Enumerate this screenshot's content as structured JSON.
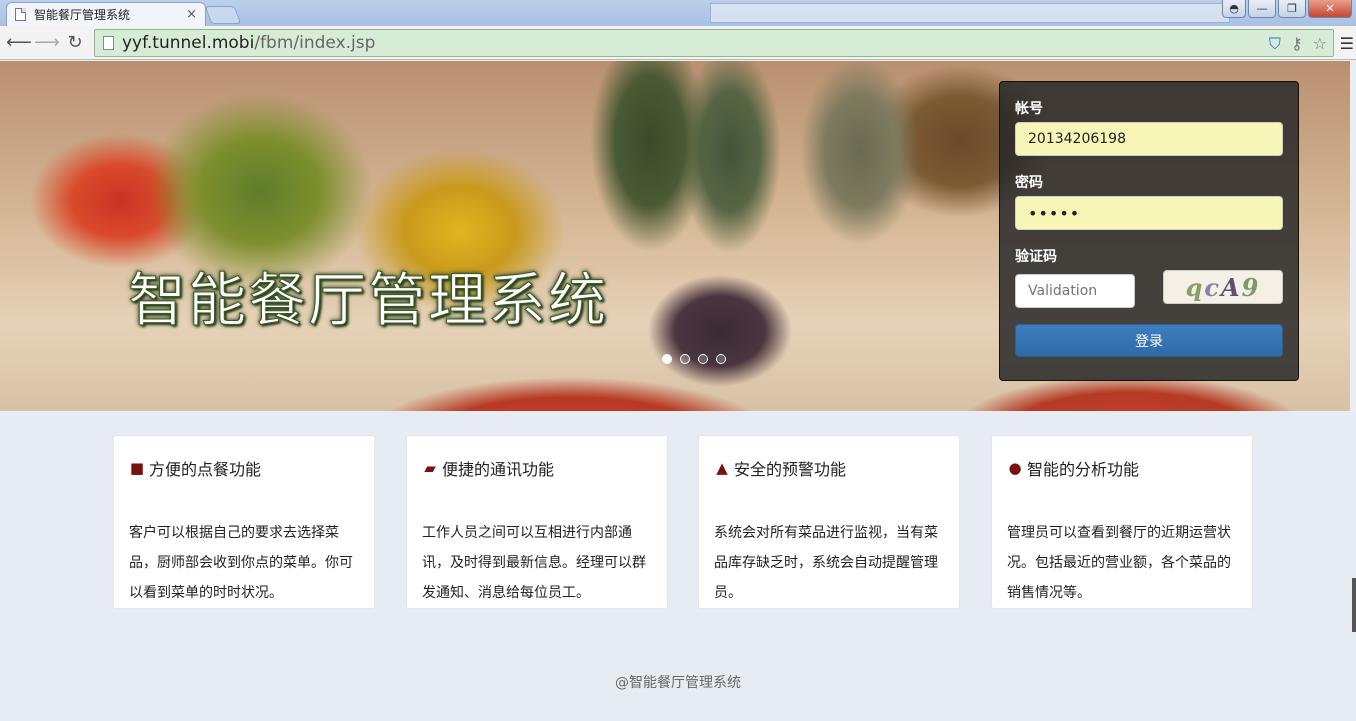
{
  "browser": {
    "tab_title": "智能餐厅管理系统",
    "tab_close": "×",
    "url_host": "yyf.tunnel.mobi",
    "url_path": "/fbm/index.jsp",
    "winbtn_user": "◓",
    "winbtn_min": "—",
    "winbtn_max": "❐",
    "winbtn_close": "✕"
  },
  "hero": {
    "title": "智能餐厅管理系统",
    "slides": 4,
    "active_slide": 1
  },
  "login": {
    "account_label": "帐号",
    "account_value": "20134206198",
    "password_label": "密码",
    "password_value": "12345",
    "captcha_label": "验证码",
    "captcha_placeholder": "Validation",
    "captcha_chars": [
      "q",
      "c",
      "A",
      "9"
    ],
    "submit_label": "登录"
  },
  "features": [
    {
      "icon": "book-icon",
      "title": "方便的点餐功能",
      "text": "客户可以根据自己的要求去选择菜品，厨师部会收到你点的菜单。你可以看到菜单的时时状况。"
    },
    {
      "icon": "comment-icon",
      "title": "便捷的通讯功能",
      "text": "工作人员之间可以互相进行内部通讯，及时得到最新信息。经理可以群发通知、消息给每位员工。"
    },
    {
      "icon": "warning-icon",
      "title": "安全的预警功能",
      "text": "系统会对所有菜品进行监视，当有菜品库存缺乏时，系统会自动提醒管理员。"
    },
    {
      "icon": "apple-icon",
      "title": "智能的分析功能",
      "text": "管理员可以查看到餐厅的近期运营状况。包括最近的营业额，各个菜品的销售情况等。"
    }
  ],
  "footer": "@智能餐厅管理系统"
}
